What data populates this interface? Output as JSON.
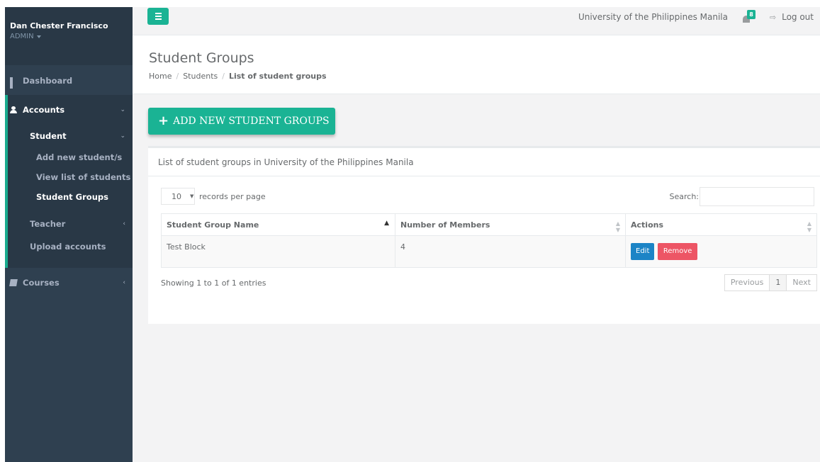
{
  "sidebar": {
    "user_name": "Dan Chester Francisco",
    "user_role": "ADMIN",
    "items": {
      "dashboard": "Dashboard",
      "accounts": "Accounts",
      "student": "Student",
      "add_student": "Add new student/s",
      "view_students": "View list of students",
      "student_groups": "Student Groups",
      "teacher": "Teacher",
      "upload_accounts": "Upload accounts",
      "courses": "Courses"
    }
  },
  "topbar": {
    "org_name": "University of the Philippines Manila",
    "notification_count": "8",
    "logout_label": "Log out"
  },
  "heading": {
    "title": "Student Groups",
    "breadcrumb": [
      "Home",
      "Students",
      "List of student groups"
    ]
  },
  "main": {
    "add_button_label": "ADD NEW STUDENT GROUPS",
    "panel_title": "List of student groups in University of the Philippines Manila",
    "page_length": "10",
    "page_length_suffix": "records per page",
    "search_label": "Search:",
    "search_value": "",
    "columns": [
      "Student Group Name",
      "Number of Members",
      "Actions"
    ],
    "rows": [
      {
        "name": "Test Block",
        "members": "4",
        "edit_label": "Edit",
        "remove_label": "Remove"
      }
    ],
    "info": "Showing 1 to 1 of 1 entries",
    "pagination": {
      "previous": "Previous",
      "current": "1",
      "next": "Next"
    }
  },
  "colors": {
    "sidebar_bg": "#2f4050",
    "accent": "#1ab394",
    "edit_button": "#1c84c6",
    "remove_button": "#ed5565"
  },
  "icons": {
    "hamburger": "menu-icon",
    "dashboard": "grid-icon",
    "accounts": "user-icon",
    "courses": "book-icon",
    "notifications": "bell-icon",
    "logout": "sign-out-icon"
  }
}
